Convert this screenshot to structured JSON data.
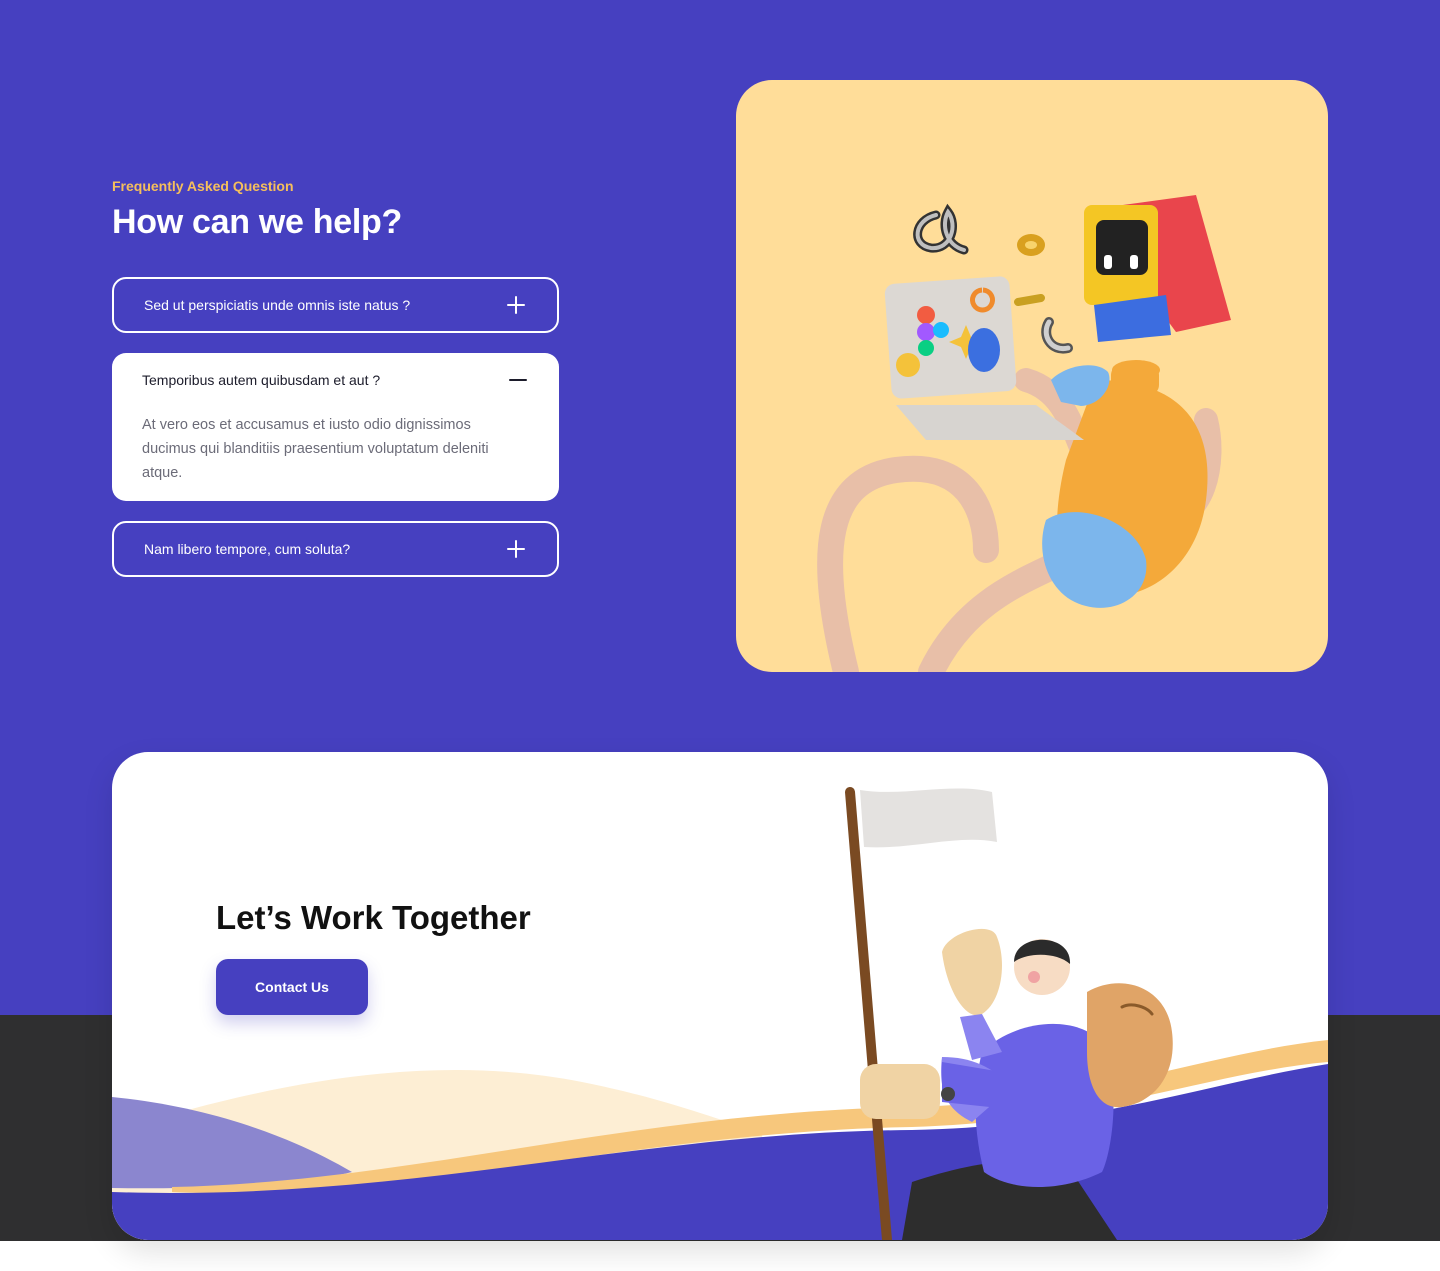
{
  "faq_section": {
    "eyebrow": "Frequently Asked Question",
    "headline": "How can we help?",
    "items": [
      {
        "question": "Sed ut perspiciatis unde omnis iste natus ?",
        "expanded": false,
        "toggle_icon": "plus-icon"
      },
      {
        "question": "Temporibus autem quibusdam et aut ?",
        "expanded": true,
        "toggle_icon": "minus-icon",
        "answer": "At vero eos et accusamus et iusto odio dignissimos ducimus qui blanditiis praesentium voluptatum deleniti atque."
      },
      {
        "question": "Nam libero tempore, cum soluta?",
        "expanded": false,
        "toggle_icon": "plus-icon"
      }
    ]
  },
  "hero_illustration": {
    "icon": "3d-character-with-laptop-illustration"
  },
  "cta": {
    "title": "Let’s Work Together",
    "button_label": "Contact Us",
    "illustration": "3d-hiker-with-flag-illustration"
  },
  "colors": {
    "primary": "#4640c0",
    "accent": "#f5bf5c",
    "hero_bg": "#ffdd99",
    "footer_dark": "#2f2f30"
  }
}
